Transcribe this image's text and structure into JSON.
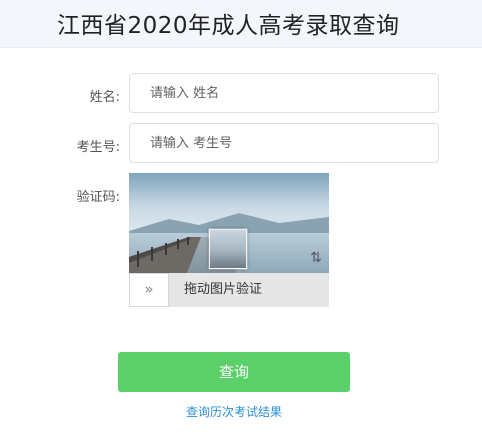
{
  "header": {
    "title": "江西省2020年成人高考录取查询"
  },
  "form": {
    "name_label": "姓名:",
    "name_placeholder": "请输入 姓名",
    "exam_no_label": "考生号:",
    "exam_no_placeholder": "请输入 考生号",
    "captcha_label": "验证码:"
  },
  "captcha": {
    "handle_glyph": "»",
    "slider_text": "拖动图片验证",
    "refresh_glyph": "⇅"
  },
  "actions": {
    "query_label": "查询",
    "history_link": "查询历次考试结果"
  }
}
